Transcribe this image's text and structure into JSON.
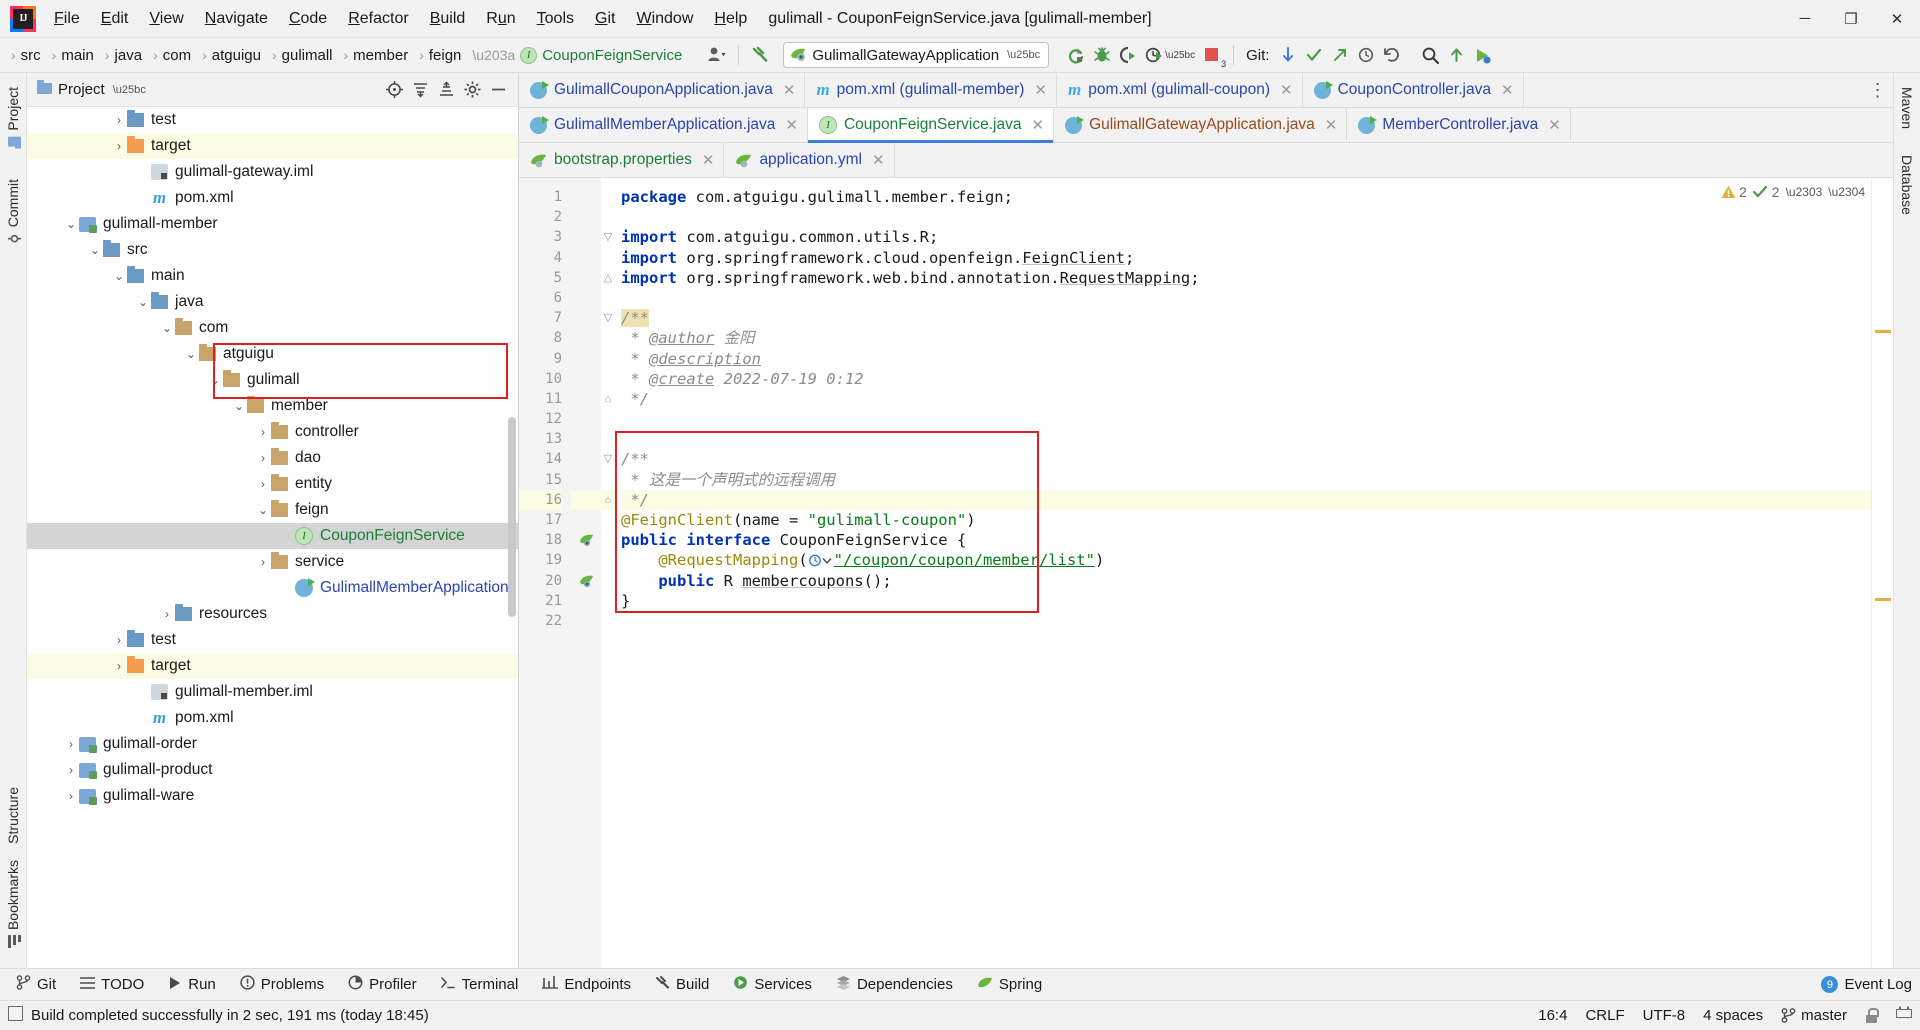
{
  "window": {
    "title": "gulimall - CouponFeignService.java [gulimall-member]",
    "minimize": "─",
    "maximize": "❐",
    "close": "✕"
  },
  "menubar": [
    {
      "label": "File",
      "mnemonic": "F"
    },
    {
      "label": "Edit",
      "mnemonic": "E"
    },
    {
      "label": "View",
      "mnemonic": "V"
    },
    {
      "label": "Navigate",
      "mnemonic": "N"
    },
    {
      "label": "Code",
      "mnemonic": "C"
    },
    {
      "label": "Refactor",
      "mnemonic": "R"
    },
    {
      "label": "Build",
      "mnemonic": "B"
    },
    {
      "label": "Run",
      "mnemonic": "u"
    },
    {
      "label": "Tools",
      "mnemonic": "T"
    },
    {
      "label": "Git",
      "mnemonic": "G"
    },
    {
      "label": "Window",
      "mnemonic": "W"
    },
    {
      "label": "Help",
      "mnemonic": "H"
    }
  ],
  "navbar": {
    "breadcrumbs": [
      "src",
      "main",
      "java",
      "com",
      "atguigu",
      "gulimall",
      "member",
      "feign"
    ],
    "current": "CouponFeignService",
    "run_config": "GulimallGatewayApplication",
    "git_label": "Git:",
    "stop_badge": "3"
  },
  "project_panel": {
    "title": "Project",
    "tree": [
      {
        "indent": 3,
        "arrow": "›",
        "icon": "folder-blue",
        "label": "test"
      },
      {
        "indent": 3,
        "arrow": "›",
        "icon": "folder-orange",
        "label": "target",
        "hl": "yellow"
      },
      {
        "indent": 4,
        "arrow": "",
        "icon": "iml",
        "label": "gulimall-gateway.iml"
      },
      {
        "indent": 4,
        "arrow": "",
        "icon": "maven",
        "label": "pom.xml"
      },
      {
        "indent": 1,
        "arrow": "⌄",
        "icon": "module",
        "label": "gulimall-member"
      },
      {
        "indent": 2,
        "arrow": "⌄",
        "icon": "folder-blue",
        "label": "src"
      },
      {
        "indent": 3,
        "arrow": "⌄",
        "icon": "folder-blue",
        "label": "main"
      },
      {
        "indent": 4,
        "arrow": "⌄",
        "icon": "folder-blue",
        "label": "java"
      },
      {
        "indent": 5,
        "arrow": "⌄",
        "icon": "folder-tan",
        "label": "com"
      },
      {
        "indent": 6,
        "arrow": "⌄",
        "icon": "folder-tan",
        "label": "atguigu"
      },
      {
        "indent": 7,
        "arrow": "⌄",
        "icon": "folder-tan",
        "label": "gulimall"
      },
      {
        "indent": 8,
        "arrow": "⌄",
        "icon": "folder-tan",
        "label": "member"
      },
      {
        "indent": 9,
        "arrow": "›",
        "icon": "folder-tan",
        "label": "controller"
      },
      {
        "indent": 9,
        "arrow": "›",
        "icon": "folder-tan",
        "label": "dao"
      },
      {
        "indent": 9,
        "arrow": "›",
        "icon": "folder-tan",
        "label": "entity"
      },
      {
        "indent": 9,
        "arrow": "⌄",
        "icon": "folder-tan",
        "label": "feign"
      },
      {
        "indent": 10,
        "arrow": "",
        "icon": "interface",
        "label": "CouponFeignService",
        "hl": "gray",
        "green": true
      },
      {
        "indent": 9,
        "arrow": "›",
        "icon": "folder-tan",
        "label": "service"
      },
      {
        "indent": 10,
        "arrow": "",
        "icon": "class",
        "label": "GulimallMemberApplication",
        "blue": true
      },
      {
        "indent": 5,
        "arrow": "›",
        "icon": "folder-blue",
        "label": "resources"
      },
      {
        "indent": 3,
        "arrow": "›",
        "icon": "folder-blue",
        "label": "test"
      },
      {
        "indent": 3,
        "arrow": "›",
        "icon": "folder-orange",
        "label": "target",
        "hl": "yellow"
      },
      {
        "indent": 4,
        "arrow": "",
        "icon": "iml",
        "label": "gulimall-member.iml"
      },
      {
        "indent": 4,
        "arrow": "",
        "icon": "maven",
        "label": "pom.xml"
      },
      {
        "indent": 1,
        "arrow": "›",
        "icon": "module",
        "label": "gulimall-order"
      },
      {
        "indent": 1,
        "arrow": "›",
        "icon": "module",
        "label": "gulimall-product"
      },
      {
        "indent": 1,
        "arrow": "›",
        "icon": "module",
        "label": "gulimall-ware"
      }
    ]
  },
  "editor_tabs": {
    "row1": [
      {
        "label": "GulimallCouponApplication.java",
        "icon": "spring-class",
        "color": "blue",
        "active": false
      },
      {
        "label": "pom.xml (gulimall-member)",
        "icon": "maven",
        "color": "blue",
        "active": false
      },
      {
        "label": "pom.xml (gulimall-coupon)",
        "icon": "maven",
        "color": "blue",
        "active": false
      },
      {
        "label": "CouponController.java",
        "icon": "class",
        "color": "blue",
        "active": false
      }
    ],
    "row2": [
      {
        "label": "GulimallMemberApplication.java",
        "icon": "spring-class",
        "color": "blue",
        "active": false
      },
      {
        "label": "CouponFeignService.java",
        "icon": "interface",
        "color": "green",
        "active": true
      },
      {
        "label": "GulimallGatewayApplication.java",
        "icon": "spring-class",
        "color": "brown",
        "active": false
      },
      {
        "label": "MemberController.java",
        "icon": "class",
        "color": "blue",
        "active": false
      }
    ],
    "row3": [
      {
        "label": "bootstrap.properties",
        "icon": "spring-leaf",
        "color": "green",
        "active": false
      },
      {
        "label": "application.yml",
        "icon": "spring-leaf",
        "color": "blue",
        "active": false
      }
    ],
    "close_glyph": "✕",
    "overflow_glyph": "⋮"
  },
  "code": {
    "lines": [
      {
        "n": 1,
        "html": "<span class=\"kw\">package</span> com.atguigu.gulimall.member.feign;"
      },
      {
        "n": 2,
        "html": ""
      },
      {
        "n": 3,
        "html": "<span class=\"kw\">import</span> com.atguigu.common.utils.R;",
        "fold": "▽"
      },
      {
        "n": 4,
        "html": "<span class=\"kw\">import</span> org.springframework.cloud.openfeign.<span class=\"ident-u\">FeignClient</span>;"
      },
      {
        "n": 5,
        "html": "<span class=\"kw\">import</span> org.springframework.web.bind.annotation.<span class=\"ident-u\">RequestMapping</span>;",
        "fold": "△"
      },
      {
        "n": 6,
        "html": ""
      },
      {
        "n": 7,
        "html": "<span class=\"cmt hl-tok\">/**</span>",
        "fold": "▽"
      },
      {
        "n": 8,
        "html": "<span class=\"cmt\"> * </span><span class=\"tagdoc\">@author</span><span class=\"cmt\"> 金阳</span>"
      },
      {
        "n": 9,
        "html": "<span class=\"cmt\"> * </span><span class=\"tagdoc\">@description</span>"
      },
      {
        "n": 10,
        "html": "<span class=\"cmt\"> * </span><span class=\"tagdoc\">@create</span><span class=\"cmt\"> 2022-07-19 0:12</span>"
      },
      {
        "n": 11,
        "html": "<span class=\"cmt\"> */</span>",
        "fold": "⌂"
      },
      {
        "n": 12,
        "html": ""
      },
      {
        "n": 13,
        "html": ""
      },
      {
        "n": 14,
        "html": "<span class=\"cmt\">/**</span>",
        "fold": "▽"
      },
      {
        "n": 15,
        "html": "<span class=\"cmt\"> * 这是一个声明式的远程调用</span>"
      },
      {
        "n": 16,
        "html": "<span class=\"cmt\"> */</span>",
        "fold": "⌂",
        "hl": true
      },
      {
        "n": 17,
        "html": "<span class=\"ann\">@FeignClient</span>(name = <span class=\"str\">\"gulimall-coupon\"</span>)"
      },
      {
        "n": 18,
        "html": "<span class=\"kw\">public interface</span> CouponFeignService {",
        "gutter": "spring"
      },
      {
        "n": 19,
        "html": "    <span class=\"ann\">@RequestMapping</span>(<span class=\"mapping-ico\"></span><span class=\"urlstr\">\"/coupon/coupon/member/list\"</span>)"
      },
      {
        "n": 20,
        "html": "    <span class=\"kw\">public</span> R <span class=\"ident-u\">membercoupons</span>();",
        "gutter": "spring"
      },
      {
        "n": 21,
        "html": "}"
      },
      {
        "n": 22,
        "html": ""
      }
    ],
    "inspections": {
      "warnings": "2",
      "checks": "2"
    }
  },
  "left_strip": {
    "top": [
      "Project"
    ],
    "bottom": [
      "Structure",
      "Bookmarks"
    ]
  },
  "left_edge_strip": {
    "items": [
      "Commit"
    ]
  },
  "right_strip": {
    "items": [
      "Maven",
      "Database"
    ]
  },
  "tool_window_bar": {
    "items": [
      {
        "label": "Git",
        "icon": "git-icon"
      },
      {
        "label": "TODO",
        "icon": "todo-icon"
      },
      {
        "label": "Run",
        "icon": "run-icon"
      },
      {
        "label": "Problems",
        "icon": "problems-icon"
      },
      {
        "label": "Profiler",
        "icon": "profiler-icon"
      },
      {
        "label": "Terminal",
        "icon": "terminal-icon"
      },
      {
        "label": "Endpoints",
        "icon": "endpoints-icon"
      },
      {
        "label": "Build",
        "icon": "build-icon"
      },
      {
        "label": "Services",
        "icon": "services-icon"
      },
      {
        "label": "Dependencies",
        "icon": "dependencies-icon"
      },
      {
        "label": "Spring",
        "icon": "spring-icon"
      }
    ],
    "event_log": "Event Log",
    "event_log_count": "9"
  },
  "statusbar": {
    "message": "Build completed successfully in 2 sec, 191 ms (today 18:45)",
    "caret": "16:4",
    "line_sep": "CRLF",
    "encoding": "UTF-8",
    "indent": "4 spaces",
    "branch": "master"
  }
}
